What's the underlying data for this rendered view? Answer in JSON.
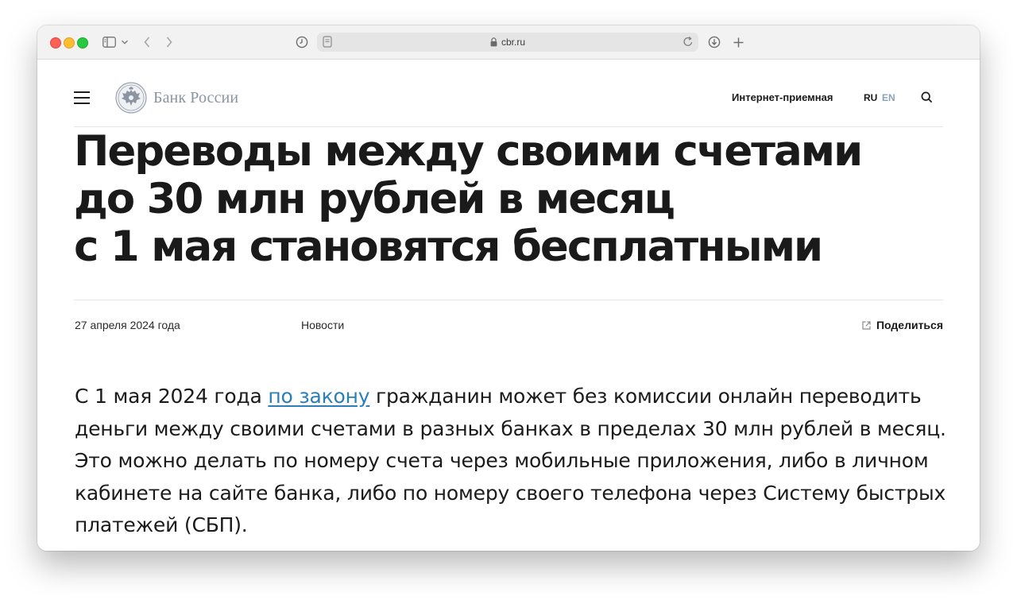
{
  "browser": {
    "url": "cbr.ru"
  },
  "site": {
    "logo_text": "Банк России",
    "reception_link": "Интернет-приемная",
    "lang_ru": "RU",
    "lang_en": "EN"
  },
  "article": {
    "title_lines": [
      "Переводы между своими счетами",
      "до 30 млн рублей в месяц",
      "с 1 мая становятся бесплатными"
    ],
    "date": "27 апреля 2024 года",
    "category": "Новости",
    "share_label": "Поделиться",
    "body": {
      "line1_before": "С 1 мая 2024 года ",
      "link_text": "по закону",
      "line1_after": " гражданин может без комиссии онлайн переводить",
      "line2": "деньги между своими счетами в разных банках в пределах 30 млн рублей в месяц.",
      "line3": "Это можно делать по номеру счета через мобильные приложения, либо в личном",
      "line4": "кабинете на сайте банка, либо по номеру своего телефона через Систему быстрых",
      "line5": "платежей (СБП)."
    }
  },
  "colors": {
    "link": "#2b7fb8",
    "lang_inactive": "#8ea0b8",
    "logo_gray": "#8a94a3"
  }
}
